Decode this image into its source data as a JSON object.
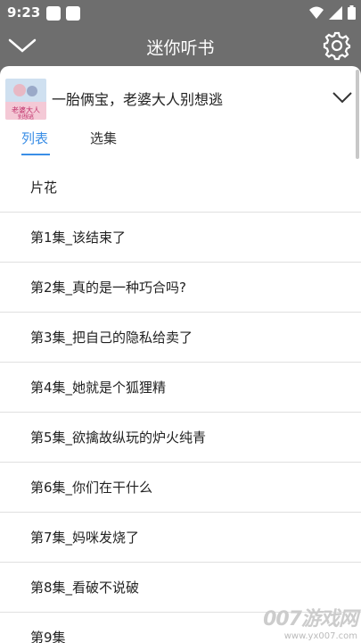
{
  "status": {
    "time": "9:23"
  },
  "app": {
    "title": "迷你听书"
  },
  "book": {
    "title": "一胎俩宝，老婆大人别想逃",
    "cover_text": "老婆大人别想逃"
  },
  "tabs": [
    {
      "label": "列表",
      "active": true
    },
    {
      "label": "选集",
      "active": false
    }
  ],
  "episodes": [
    "片花",
    "第1集_该结束了",
    "第2集_真的是一种巧合吗?",
    "第3集_把自己的隐私给卖了",
    "第4集_她就是个狐狸精",
    "第5集_欲擒故纵玩的炉火纯青",
    "第6集_你们在干什么",
    "第7集_妈咪发烧了",
    "第8集_看破不说破",
    "第9集_"
  ],
  "watermark": {
    "main": "007游戏网",
    "sub": "www.yx007.com"
  },
  "colors": {
    "accent": "#3a8ee6",
    "overlay": "#6e6e6e"
  }
}
